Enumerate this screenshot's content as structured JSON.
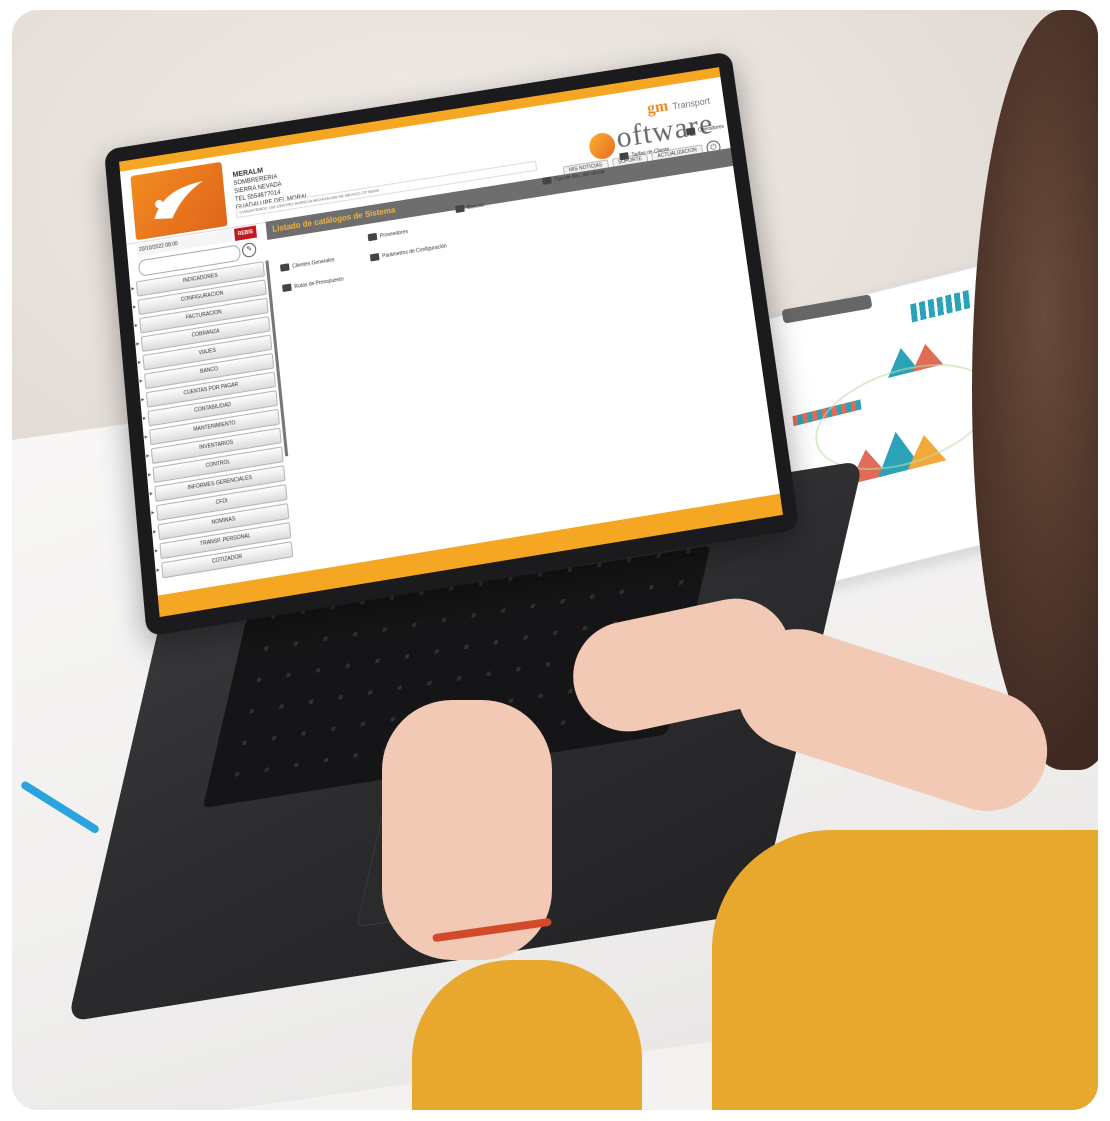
{
  "app": {
    "brand_prefix": "gm",
    "brand_sub": "Transport",
    "brand_name": "oftware",
    "company_name": "MERALM",
    "company_line1": "SOMBRERERIA",
    "company_line2": "SIERRA NEVADA",
    "company_line3": "TEL 5554677014",
    "company_line4": "GUADALUPE DEL MORAL",
    "address": "CUAUHTEMOC 100 CENTRO MORELIA MICHOACAN DE MEXICO CP 58000",
    "status_date": "20/10/2022 08:00",
    "status_badge": "REBIS"
  },
  "menubar": {
    "items": [
      "MIS NOTICIAS",
      "SOPORTE",
      "ACTUALIZACION"
    ],
    "power": "⏻"
  },
  "sidebar": {
    "items": [
      {
        "label": "INDICADORES"
      },
      {
        "label": "CONFIGURACION"
      },
      {
        "label": "FACTURACION"
      },
      {
        "label": "COBRANZA"
      },
      {
        "label": "VIAJES"
      },
      {
        "label": "BANCO"
      },
      {
        "label": "CUENTAS POR PAGAR"
      },
      {
        "label": "CONTABILIDAD"
      },
      {
        "label": "MANTENIMIENTO"
      },
      {
        "label": "INVENTARIOS"
      },
      {
        "label": "CONTROL"
      },
      {
        "label": "INFORMES GERENCIALES"
      },
      {
        "label": "CFDI"
      },
      {
        "label": "NOMINAS"
      },
      {
        "label": "TRANSP. PERSONAL"
      },
      {
        "label": "COTIZADOR"
      }
    ]
  },
  "main": {
    "title": "Listado de catálogos de Sistema",
    "shortcuts": [
      {
        "label": "Clientes Generales",
        "icon": "truck-icon"
      },
      {
        "label": "Proveedores",
        "icon": "truck-icon"
      },
      {
        "label": "Bancos",
        "icon": "bank-icon"
      },
      {
        "label": "Tipo de doc. del cliente",
        "icon": "document-icon"
      },
      {
        "label": "Tarifas de Cliente",
        "icon": "user-icon"
      },
      {
        "label": "Operadores",
        "icon": "user-icon"
      },
      {
        "label": "Rutas de Presupuesto",
        "icon": "truck-icon"
      },
      {
        "label": "Parámetros de Configuración",
        "icon": "settings-icon"
      }
    ]
  }
}
